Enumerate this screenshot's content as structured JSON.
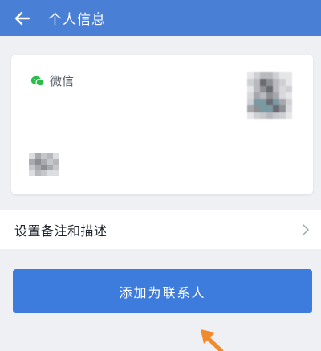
{
  "header": {
    "title": "个人信息"
  },
  "profile_card": {
    "source_label": "微信",
    "icon": "wechat-icon",
    "avatar_icon": "blurred-avatar",
    "name_icon": "blurred-name"
  },
  "remark_row": {
    "label": "设置备注和描述",
    "icon": "chevron-right-icon"
  },
  "primary_action": {
    "label": "添加为联系人"
  },
  "colors": {
    "header_bg": "#4a7fd6",
    "button_bg": "#3d7bdd",
    "wechat_green": "#2dbb4e",
    "hint_arrow": "#f08a2e",
    "page_bg": "#eef0f4"
  }
}
